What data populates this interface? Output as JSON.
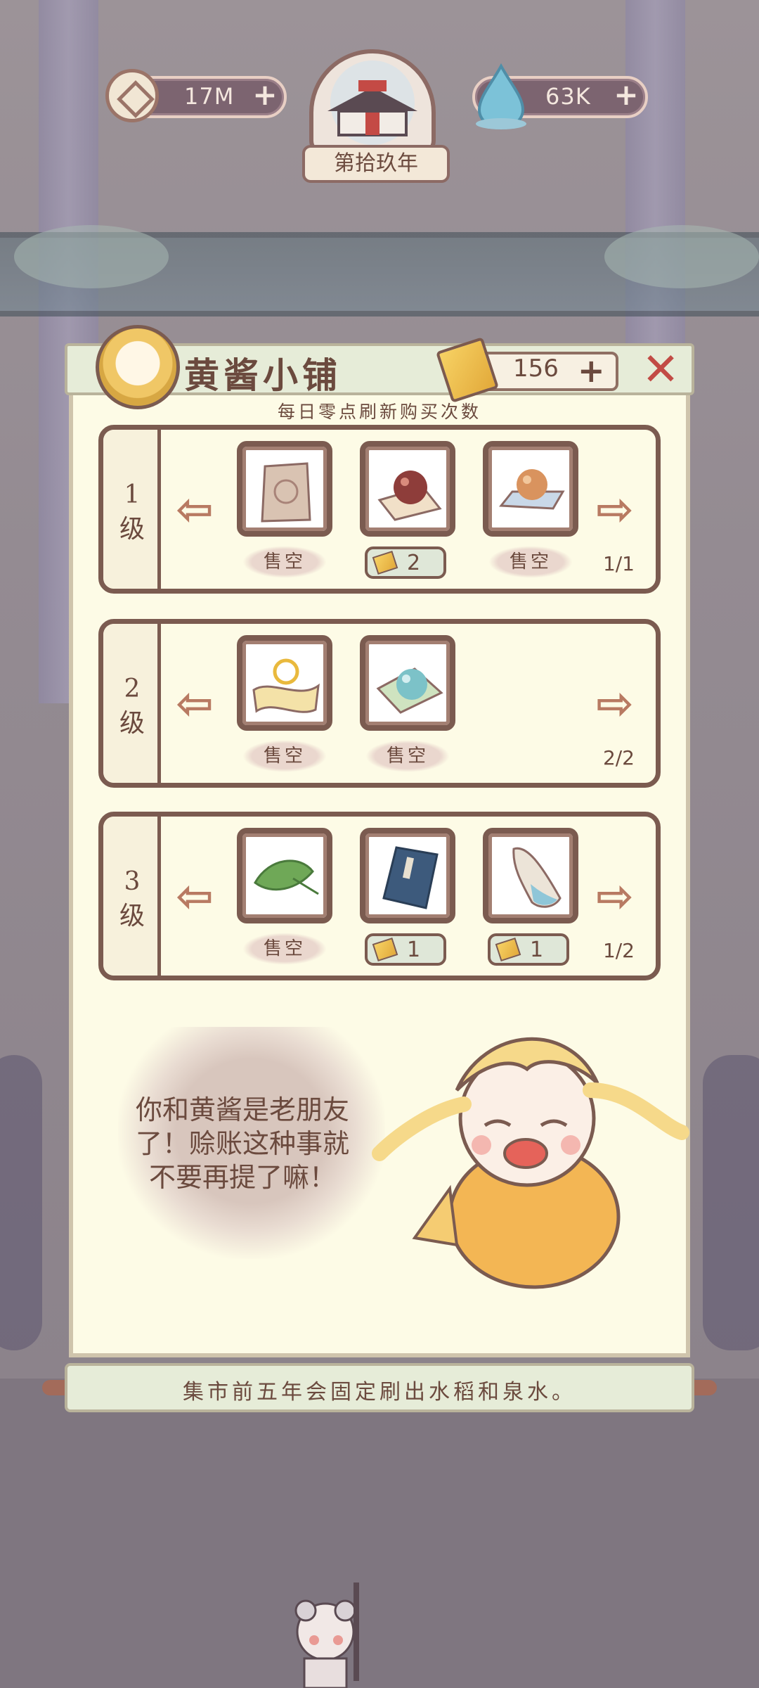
{
  "resources": {
    "coins": "17M",
    "water": "63K",
    "year": "第拾玖年"
  },
  "shop": {
    "title": "黄酱小铺",
    "tickets": "156",
    "refresh_note": "每日零点刷新购买次数",
    "tiers": [
      {
        "level": "1",
        "level_suffix": "级",
        "page": "1/1",
        "items": [
          {
            "name": "paper-pouch-icon",
            "status": "售空"
          },
          {
            "name": "red-pill-icon",
            "price": "2"
          },
          {
            "name": "orange-pill-icon",
            "status": "售空"
          }
        ]
      },
      {
        "level": "2",
        "level_suffix": "级",
        "page": "2/2",
        "items": [
          {
            "name": "golden-scroll-icon",
            "status": "售空"
          },
          {
            "name": "jade-bead-icon",
            "status": "售空"
          }
        ]
      },
      {
        "level": "3",
        "level_suffix": "级",
        "page": "1/2",
        "items": [
          {
            "name": "leaf-icon",
            "status": "售空"
          },
          {
            "name": "book-icon",
            "price": "1"
          },
          {
            "name": "flask-icon",
            "price": "1"
          }
        ]
      }
    ],
    "dialogue": "你和黄酱是老朋友了！赊账这种事就不要再提了嘛！",
    "footer_tip": "集市前五年会固定刷出水稻和泉水。"
  },
  "colors": {
    "panel_bg": "#fdfbe6",
    "border_brown": "#7b5b50",
    "close_red": "#c24b45",
    "ticket_gold": "#e2a93a"
  }
}
